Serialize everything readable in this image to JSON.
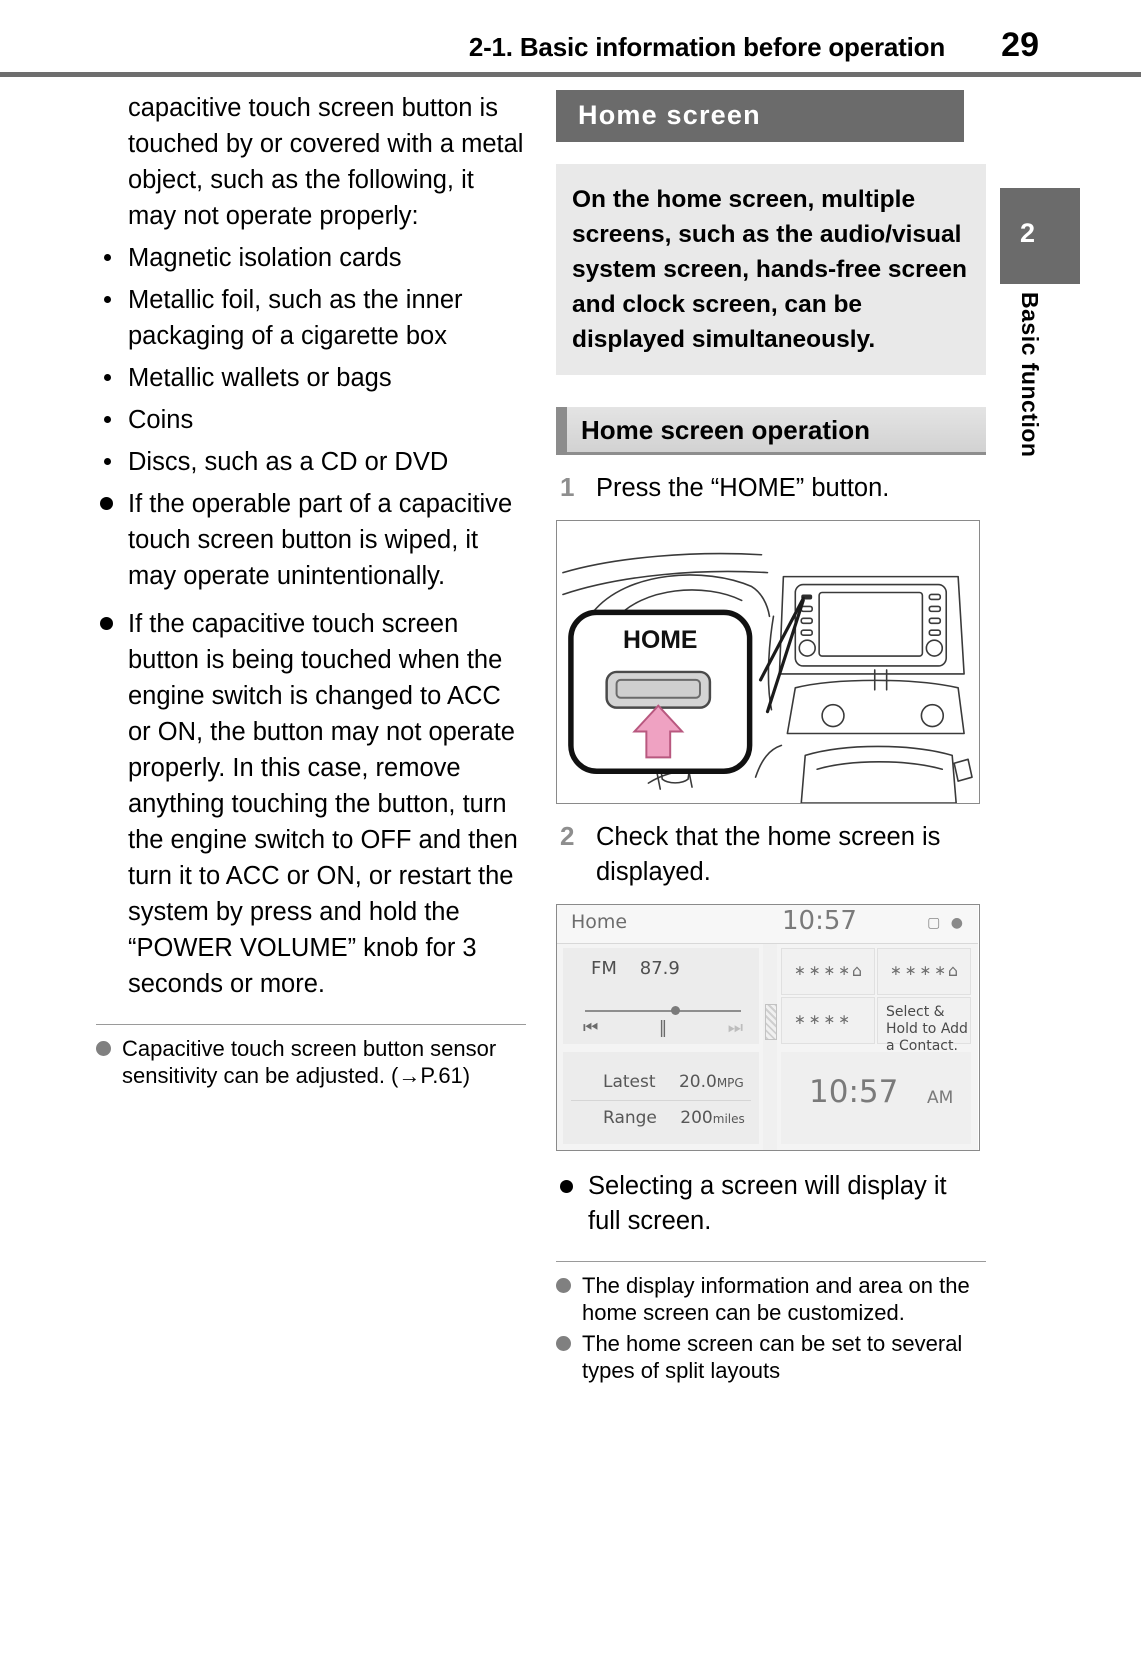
{
  "header": {
    "title": "2-1. Basic information before operation",
    "page_number": "29"
  },
  "side_tab": {
    "chapter_number": "2",
    "chapter_label": "Basic function"
  },
  "left_column": {
    "intro_paragraph": "capacitive touch screen button is touched by or covered with a metal object, such as the following, it may not operate properly:",
    "small_bullets": [
      "Magnetic isolation cards",
      "Metallic foil, such as the inner packaging of a cigarette box",
      "Metallic wallets or bags",
      "Coins",
      "Discs, such as a CD or DVD"
    ],
    "big_bullets": [
      "If the operable part of a capacitive touch screen button is wiped, it may operate unintentionally.",
      "If the capacitive touch screen button is being touched when the engine switch is changed to ACC or ON, the button may not operate properly. In this case, remove anything touching the button, turn the engine switch to OFF and then turn it to ACC or ON, or restart the system by press and hold the “POWER VOLUME” knob for 3 seconds or more."
    ],
    "notes": [
      "Capacitive touch screen button sensor sensitivity can be adjusted. (→P.61)"
    ]
  },
  "right_column": {
    "section_title": "Home screen",
    "info_box": "On the home screen, multiple screens, such as the audio/visual system screen, hands-free screen and clock screen, can be displayed simultaneously.",
    "subsection_title": "Home screen operation",
    "steps": [
      {
        "number": "1",
        "text": "Press the “HOME” button."
      },
      {
        "number": "2",
        "text": "Check that the home screen is displayed."
      }
    ],
    "dashboard_figure": {
      "callout_label": "HOME",
      "arrow_color": "#e8a0bd"
    },
    "home_screen_figure": {
      "status_title": "Home",
      "status_clock": "10:57",
      "status_icons": "▢ ●",
      "audio": {
        "band": "FM",
        "frequency": "87.9",
        "prev_icon": "⏮",
        "pause_icon": "‖",
        "next_icon": "⏭"
      },
      "trip": {
        "row1_label": "Latest",
        "row1_value": "20.0",
        "row1_unit": "MPG",
        "row2_label": "Range",
        "row2_value": "200",
        "row2_unit": "miles"
      },
      "phone": {
        "cell1_stars": "∗∗∗∗",
        "cell1_icon": "⌂",
        "cell2_stars": "∗∗∗∗",
        "cell2_icon": "⌂",
        "cell3_stars": "∗∗∗∗",
        "cell4_hint": "Select & Hold to Add a Contact."
      },
      "clock": {
        "time": "10:57",
        "meridiem": "AM"
      }
    },
    "big_bullets": [
      "Selecting a screen will display it full screen."
    ],
    "notes": [
      "The display information and area on the home screen can be customized.",
      "The home screen can be set to several types of split layouts"
    ]
  }
}
